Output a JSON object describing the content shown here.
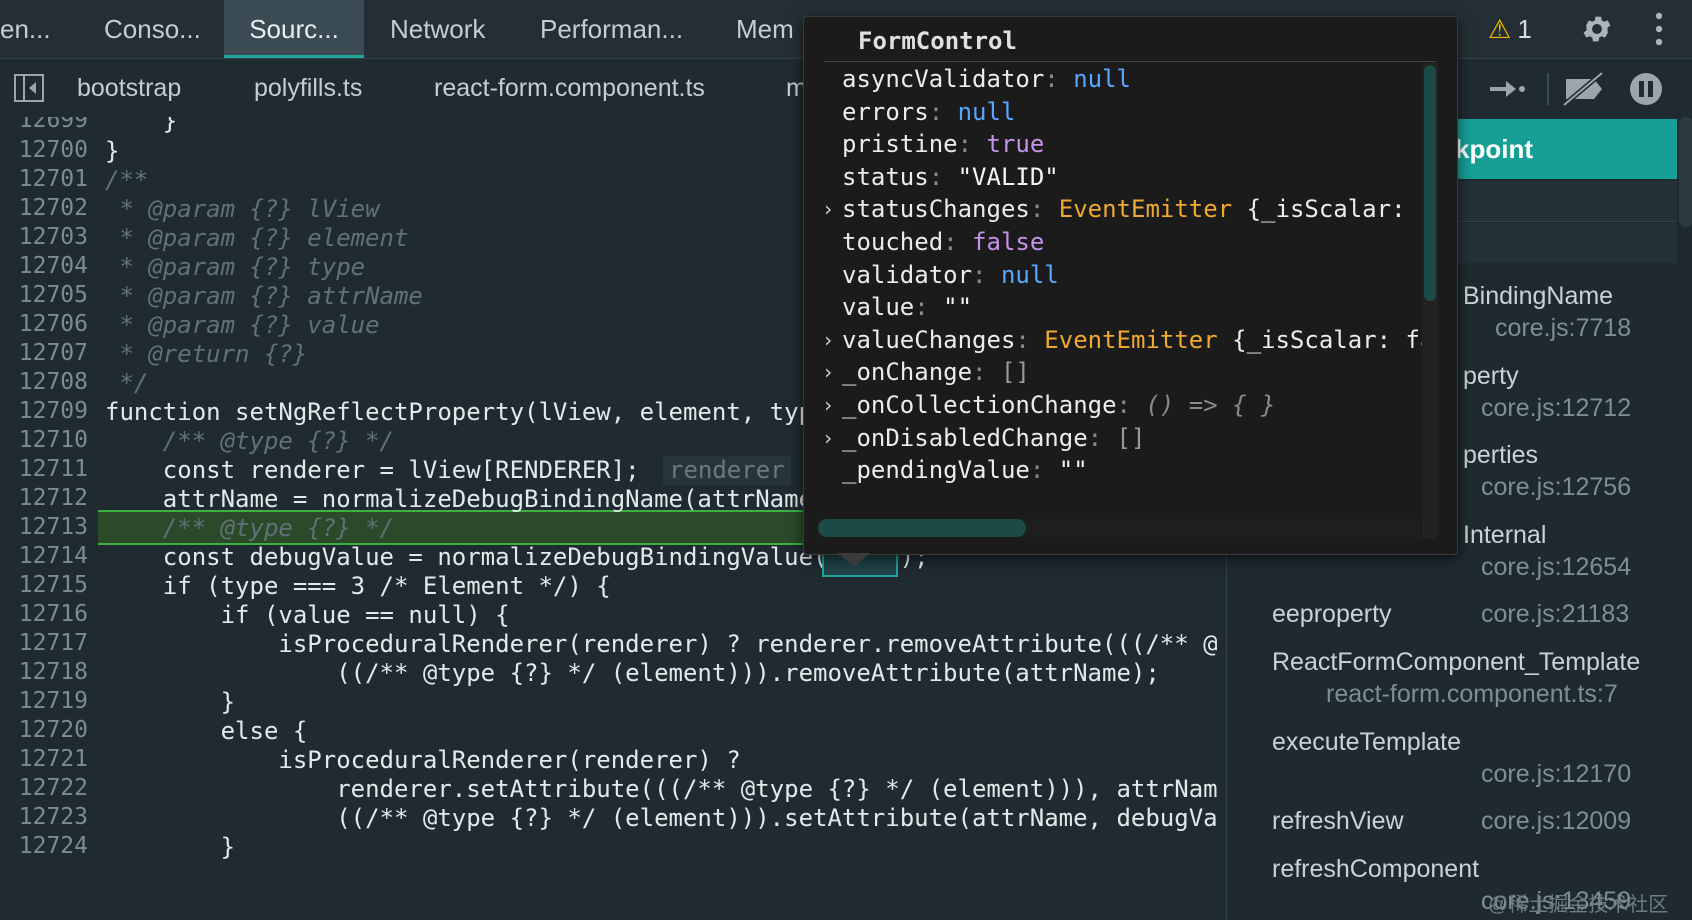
{
  "tabs": [
    "en...",
    "Conso...",
    "Sourc...",
    "Network",
    "Performan...",
    "Mem"
  ],
  "active_tab": "Sourc...",
  "warnings": {
    "count": "1"
  },
  "files": [
    "bootstrap",
    "polyfills.ts",
    "react-form.component.ts",
    "m"
  ],
  "editor": {
    "line_numbers": [
      "12699",
      "12700",
      "12701",
      "12702",
      "12703",
      "12704",
      "12705",
      "12706",
      "12707",
      "12708",
      "12709",
      "12710",
      "12711",
      "12712",
      "12713",
      "12714",
      "12715",
      "12716",
      "12717",
      "12718",
      "12719",
      "12720",
      "12721",
      "12722",
      "12723",
      "12724"
    ],
    "lines": [
      "    }",
      "}",
      "/**",
      " * @param {?} lView",
      " * @param {?} element",
      " * @param {?} type",
      " * @param {?} attrName",
      " * @param {?} value",
      " * @return {?}",
      " */",
      "function setNgReflectProperty(lView, element, typ",
      "    /** @type {?} */",
      "    const renderer = lView[RENDERER];",
      "    attrName = normalizeDebugBindingName(attrName",
      "    /** @type {?} */",
      "    const debugValue = normalizeDebugBindingValue(value);",
      "    if (type === 3 /* Element */) {",
      "        if (value == null) {",
      "            isProceduralRenderer(renderer) ? renderer.removeAttribute(((/** @",
      "                ((/** @type {?} */ (element))).removeAttribute(attrName);",
      "        }",
      "        else {",
      "            isProceduralRenderer(renderer) ?",
      "                renderer.setAttribute(((/** @type {?} */ (element))), attrNam",
      "                ((/** @type {?} */ (element))).setAttribute(attrName, debugVa",
      "        }"
    ],
    "inline_hint": "renderer",
    "highlighted_line": "12712"
  },
  "popover": {
    "title": "FormControl",
    "rows": [
      {
        "key": "asyncValidator",
        "value": "null",
        "type": "null",
        "expandable": false
      },
      {
        "key": "errors",
        "value": "null",
        "type": "null",
        "expandable": false
      },
      {
        "key": "pristine",
        "value": "true",
        "type": "bool",
        "expandable": false
      },
      {
        "key": "status",
        "value": "\"VALID\"",
        "type": "str",
        "expandable": false
      },
      {
        "key": "statusChanges",
        "value": "EventEmitter",
        "extra": " {_isScalar: f",
        "type": "cls",
        "expandable": true
      },
      {
        "key": "touched",
        "value": "false",
        "type": "bool",
        "expandable": false
      },
      {
        "key": "validator",
        "value": "null",
        "type": "null",
        "expandable": false
      },
      {
        "key": "value",
        "value": "\"\"",
        "type": "str",
        "expandable": false
      },
      {
        "key": "valueChanges",
        "value": "EventEmitter",
        "extra": " {_isScalar: fa",
        "type": "cls",
        "expandable": true
      },
      {
        "key": "_onChange",
        "value": "[]",
        "type": "gray",
        "expandable": true
      },
      {
        "key": "_onCollectionChange",
        "value": "() => { }",
        "type": "fn",
        "expandable": true
      },
      {
        "key": "_onDisabledChange",
        "value": "[]",
        "type": "gray",
        "expandable": true
      },
      {
        "key": "_pendingValue",
        "value": "\"\"",
        "type": "str",
        "expandable": false
      }
    ]
  },
  "right_panel": {
    "banner": "kpoint",
    "frames": [
      {
        "name": "BindingName",
        "loc": "core.js:7718"
      },
      {
        "name": "perty",
        "loc": "core.js:12712"
      },
      {
        "name": "perties",
        "loc": "core.js:12756"
      },
      {
        "name": "Internal",
        "loc": "core.js:12654"
      },
      {
        "name": "eeproperty",
        "loc": "core.js:21183"
      },
      {
        "name": "ReactFormComponent_Template",
        "loc": "react-form.component.ts:7"
      },
      {
        "name": "executeTemplate",
        "loc": "core.js:12170"
      },
      {
        "name": "refreshView",
        "loc": "core.js:12009"
      },
      {
        "name": "refreshComponent",
        "loc": "core.js:13459"
      }
    ]
  },
  "watermark": "@稀土掘金技术社区",
  "colors": {
    "accent": "#16a095",
    "breakpoint_line": "#3cb043",
    "warning": "#f2b400"
  }
}
